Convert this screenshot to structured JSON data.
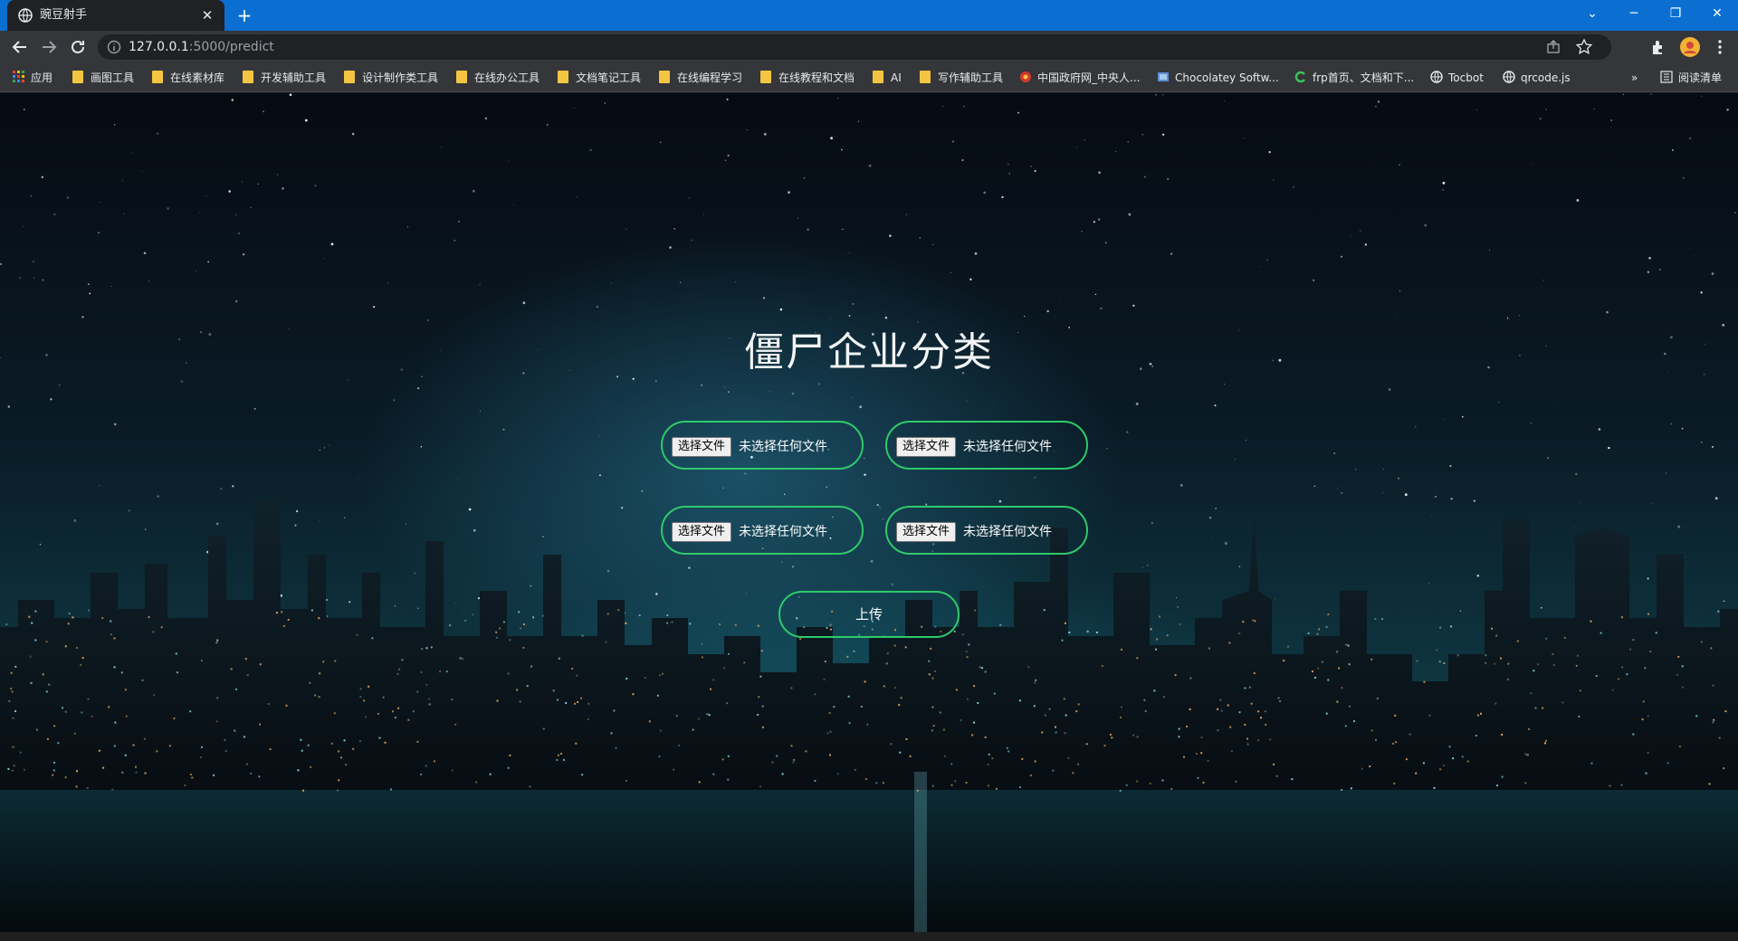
{
  "browser": {
    "tab_title": "豌豆射手",
    "new_tab": "+",
    "url_host": "127.0.0.1",
    "url_path": ":5000/predict"
  },
  "bookmarks": {
    "apps": "应用",
    "items": [
      "画图工具",
      "在线素材库",
      "开发辅助工具",
      "设计制作类工具",
      "在线办公工具",
      "文档笔记工具",
      "在线编程学习",
      "在线教程和文档",
      "AI",
      "写作辅助工具"
    ],
    "sites": [
      "中国政府网_中央人...",
      "Chocolatey Softw...",
      "frp首页、文档和下...",
      "Tocbot",
      "qrcode.js"
    ],
    "overflow": "»",
    "reading_list": "阅读清单"
  },
  "page": {
    "title": "僵尸企业分类",
    "file_inputs": [
      {
        "button": "选择文件",
        "status": "未选择任何文件"
      },
      {
        "button": "选择文件",
        "status": "未选择任何文件"
      },
      {
        "button": "选择文件",
        "status": "未选择任何文件"
      },
      {
        "button": "选择文件",
        "status": "未选择任何文件"
      }
    ],
    "upload_label": "上传"
  },
  "colors": {
    "accent_green": "#2fca6a",
    "titlebar_blue": "#0a6fd1"
  }
}
